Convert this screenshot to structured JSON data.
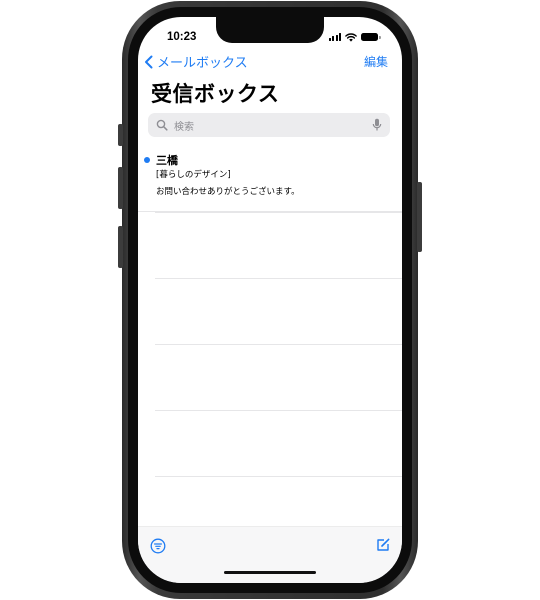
{
  "status": {
    "time": "10:23"
  },
  "nav": {
    "back_label": "メールボックス",
    "edit_label": "編集"
  },
  "page": {
    "title": "受信ボックス"
  },
  "search": {
    "placeholder": "検索"
  },
  "mails": [
    {
      "sender": "三橋",
      "subject": "[暮らしのデザイン]",
      "preview": "お問い合わせありがとうございます。",
      "unread": true
    }
  ],
  "colors": {
    "accent": "#1f7cf3",
    "search_bg": "#ececee",
    "toolbar_bg": "#f7f7f8"
  },
  "icons": [
    "chevron-left-icon",
    "search-icon",
    "mic-icon",
    "filter-icon",
    "compose-icon",
    "signal-icon",
    "wifi-icon",
    "battery-icon"
  ]
}
